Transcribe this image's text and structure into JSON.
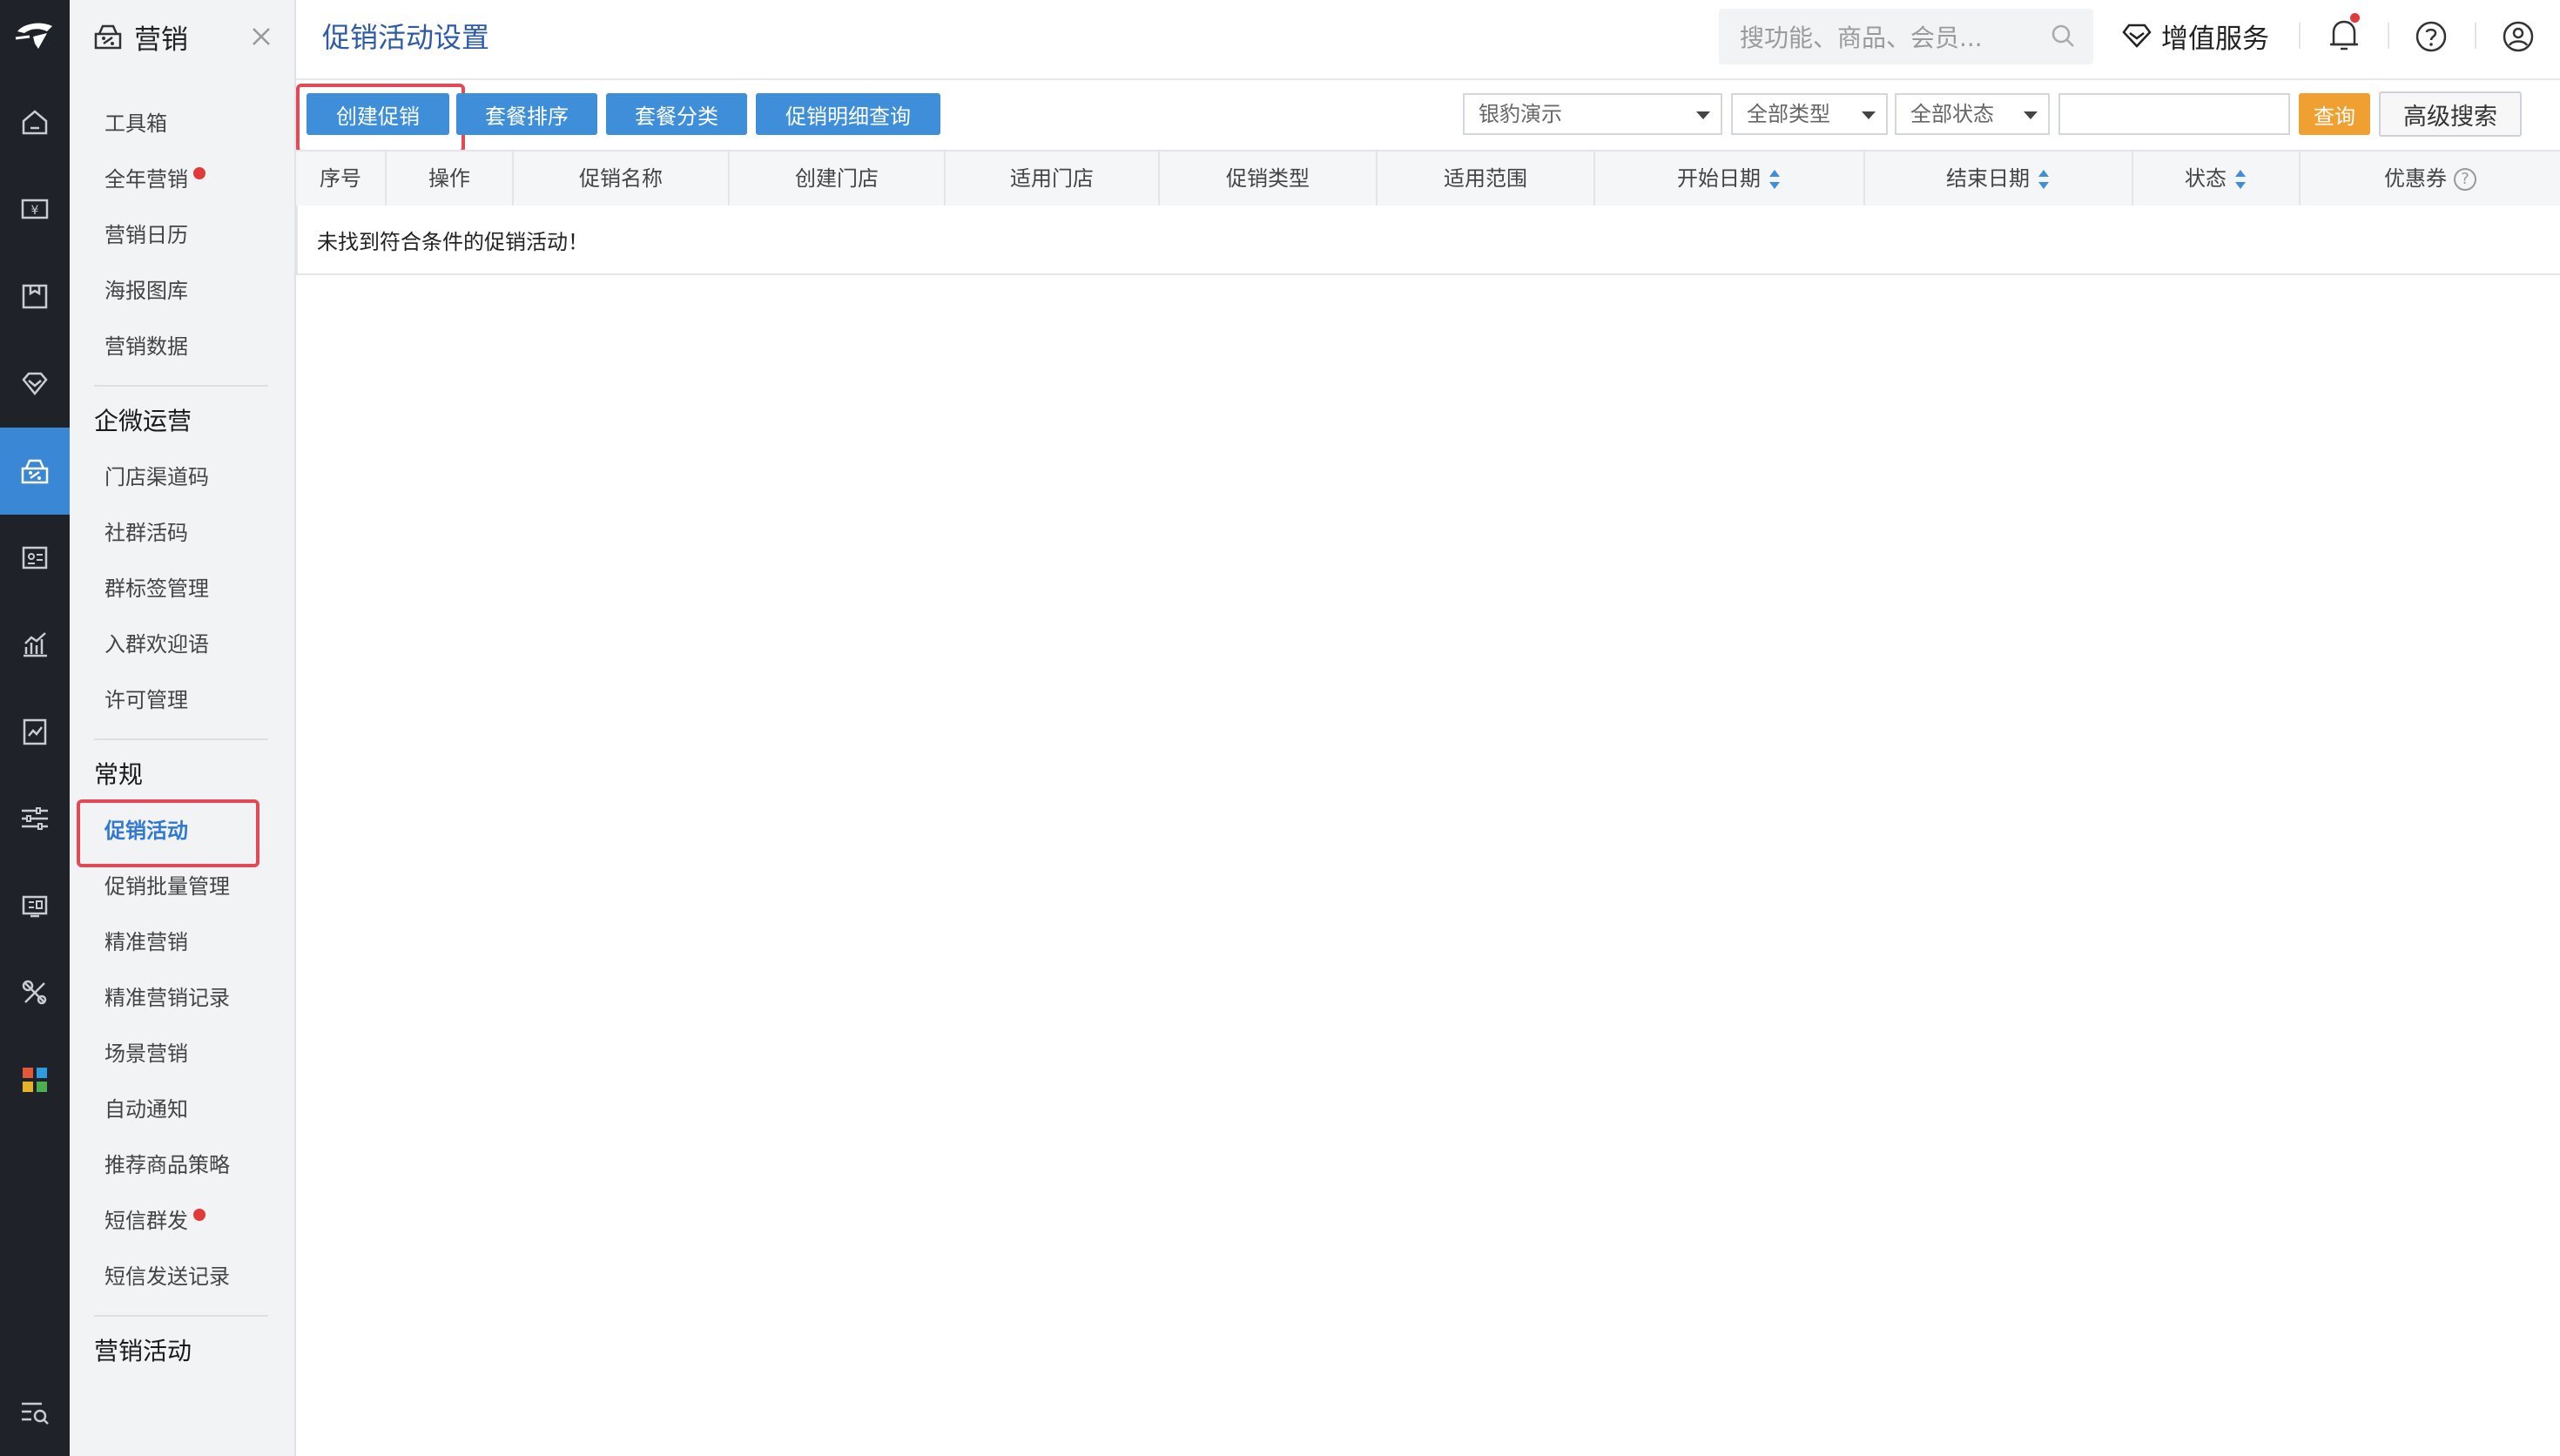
{
  "app": {
    "module_title": "营销"
  },
  "rail": {
    "icons": [
      "logo",
      "home-icon",
      "cashier-icon",
      "goods-icon",
      "member-icon",
      "marketing-icon",
      "card-icon",
      "report-icon",
      "finance-icon",
      "settings-icon",
      "device-icon",
      "tools-icon",
      "apps-icon",
      "menu-search-icon"
    ],
    "active_color": "#3a87d6"
  },
  "sidebar": {
    "top_items": [
      {
        "label": "工具箱"
      },
      {
        "label": "全年营销",
        "badge": true
      },
      {
        "label": "营销日历"
      },
      {
        "label": "海报图库"
      },
      {
        "label": "营销数据"
      }
    ],
    "group_wecom": {
      "title": "企微运营",
      "items": [
        {
          "label": "门店渠道码"
        },
        {
          "label": "社群活码"
        },
        {
          "label": "群标签管理"
        },
        {
          "label": "入群欢迎语"
        },
        {
          "label": "许可管理"
        }
      ]
    },
    "group_general": {
      "title": "常规",
      "items": [
        {
          "label": "促销活动",
          "active": true
        },
        {
          "label": "促销批量管理"
        },
        {
          "label": "精准营销"
        },
        {
          "label": "精准营销记录"
        },
        {
          "label": "场景营销"
        },
        {
          "label": "自动通知"
        },
        {
          "label": "推荐商品策略"
        },
        {
          "label": "短信群发",
          "badge": true
        },
        {
          "label": "短信发送记录"
        }
      ]
    },
    "group_activity": {
      "title": "营销活动"
    }
  },
  "header": {
    "title": "促销活动设置",
    "search_placeholder": "搜功能、商品、会员...",
    "value_added": "增值服务"
  },
  "toolbar": {
    "create": "创建促销",
    "package_sort": "套餐排序",
    "package_category": "套餐分类",
    "detail_query": "促销明细查询",
    "store_select": "银豹演示",
    "type_select": "全部类型",
    "status_select": "全部状态",
    "keyword_value": "",
    "query": "查询",
    "advanced": "高级搜索"
  },
  "table": {
    "columns": [
      "序号",
      "操作",
      "促销名称",
      "创建门店",
      "适用门店",
      "促销类型",
      "适用范围",
      "开始日期",
      "结束日期",
      "状态",
      "优惠券"
    ],
    "empty_text": "未找到符合条件的促销活动！"
  },
  "colors": {
    "accent": "#3e8ed9",
    "highlight": "#e24a57",
    "query": "#f0a030",
    "rail_bg": "#1f2329"
  }
}
